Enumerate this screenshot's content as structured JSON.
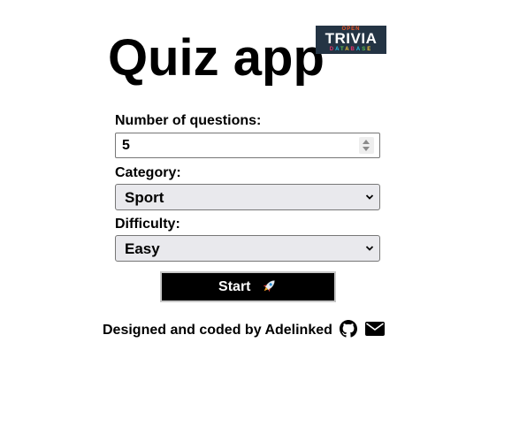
{
  "header": {
    "title": "Quiz app",
    "logo": {
      "top_text": "OPEN",
      "main_text": "TRIVIA",
      "bottom_text": "DATABASE"
    }
  },
  "form": {
    "questions": {
      "label": "Number of questions:",
      "value": "5"
    },
    "category": {
      "label": "Category:",
      "selected": "Sport"
    },
    "difficulty": {
      "label": "Difficulty:",
      "selected": "Easy"
    },
    "start_label": "Start"
  },
  "footer": {
    "credit": "Designed and coded by Adelinked",
    "icons": [
      "github-icon",
      "envelope-icon"
    ]
  },
  "colors": {
    "text": "#000000",
    "button_bg": "#000000",
    "button_text": "#ffffff",
    "select_bg": "#e9e9ed",
    "logo_bg": "#243444",
    "logo_accent": "#f05a28"
  }
}
